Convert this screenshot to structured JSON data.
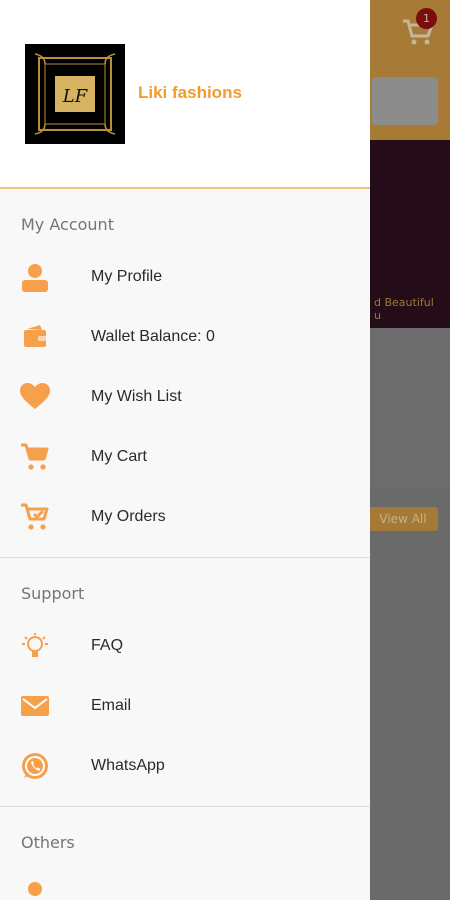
{
  "store": {
    "name": "Liki fashions",
    "logo_text": "LF"
  },
  "sections": [
    {
      "title": "My Account",
      "items": [
        {
          "label": "My Profile",
          "icon": "person-icon"
        },
        {
          "label": "Wallet Balance: 0",
          "icon": "wallet-icon"
        },
        {
          "label": "My Wish List",
          "icon": "heart-icon"
        },
        {
          "label": "My Cart",
          "icon": "cart-icon"
        },
        {
          "label": "My Orders",
          "icon": "orders-cart-icon"
        }
      ]
    },
    {
      "title": "Support",
      "items": [
        {
          "label": "FAQ",
          "icon": "lightbulb-icon"
        },
        {
          "label": "Email",
          "icon": "mail-icon"
        },
        {
          "label": "WhatsApp",
          "icon": "whatsapp-icon"
        }
      ]
    },
    {
      "title": "Others",
      "items": []
    }
  ],
  "background": {
    "cart_badge": "1",
    "banner_text": "d Beautiful\nu",
    "view_all": "View All"
  },
  "colors": {
    "accent": "#f39c2b",
    "icon": "#f7a04b"
  }
}
